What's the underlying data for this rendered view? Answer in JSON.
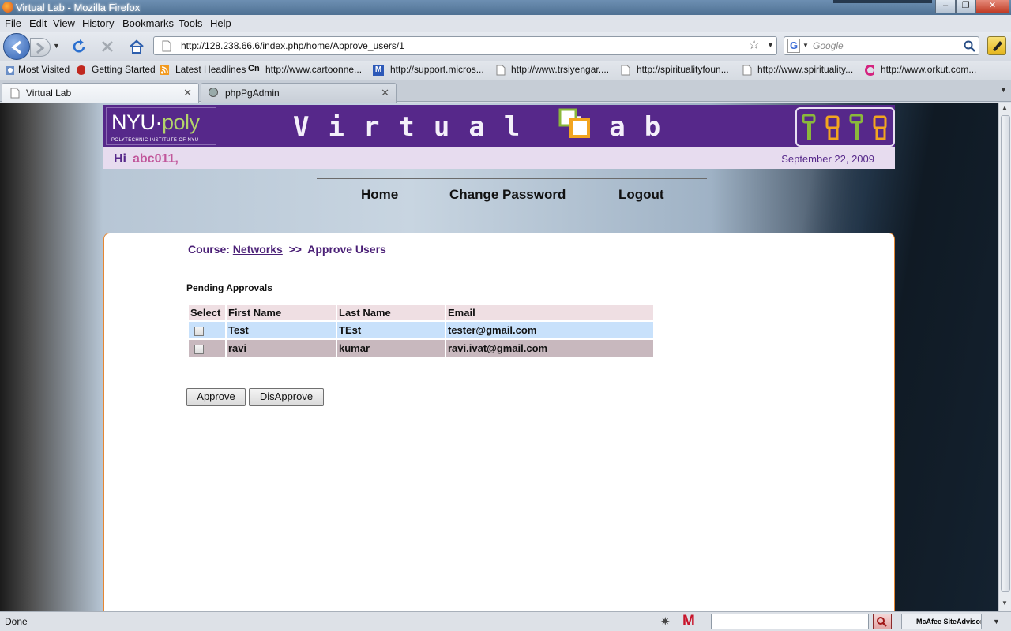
{
  "window": {
    "title": "Virtual Lab - Mozilla Firefox"
  },
  "menu": [
    "File",
    "Edit",
    "View",
    "History",
    "Bookmarks",
    "Tools",
    "Help"
  ],
  "address": {
    "url": "http://128.238.66.6/index.php/home/Approve_users/1"
  },
  "search": {
    "placeholder": "Google"
  },
  "bookmarks": [
    "Most Visited",
    "Getting Started",
    "Latest Headlines",
    "http://www.cartoonne...",
    "http://support.micros...",
    "http://www.trsiyengar....",
    "http://spiritualityfoun...",
    "http://www.spirituality...",
    "http://www.orkut.com..."
  ],
  "tabs": [
    {
      "label": "Virtual Lab",
      "active": true
    },
    {
      "label": "phpPgAdmin",
      "active": false
    }
  ],
  "page": {
    "logo_main": "NYU",
    "logo_dot": "·",
    "logo_poly": "poly",
    "logo_sub": "POLYTECHNIC INSTITUTE OF NYU",
    "site_title": "Virtual Lab",
    "greeting": "Hi",
    "username": "abc011,",
    "date": "September 22, 2009",
    "nav": [
      "Home",
      "Change Password",
      "Logout"
    ],
    "breadcrumb": {
      "course_label": "Course:",
      "course": "Networks",
      "sep": ">>",
      "current": "Approve Users"
    },
    "pending_heading": "Pending Approvals",
    "table": {
      "headers": [
        "Select",
        "First Name",
        "Last Name",
        "Email"
      ],
      "rows": [
        {
          "first": "Test",
          "last": "TEst",
          "email": "tester@gmail.com"
        },
        {
          "first": "ravi",
          "last": "kumar",
          "email": "ravi.ivat@gmail.com"
        }
      ]
    },
    "approve_label": "Approve",
    "disapprove_label": "DisApprove"
  },
  "status": {
    "text": "Done",
    "siteadvisor": "McAfee SiteAdvisor"
  },
  "colors": {
    "header": "#56288a",
    "accent": "#c1579b",
    "panel_border": "#e58632"
  }
}
